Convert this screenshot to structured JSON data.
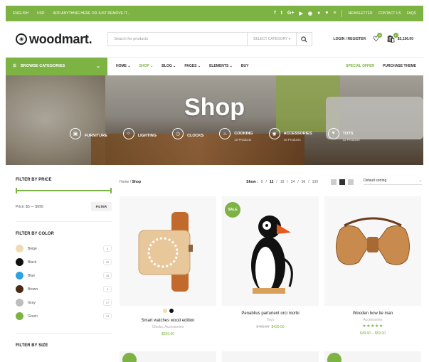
{
  "topbar": {
    "language": "ENGLISH",
    "currency": "USD",
    "promo": "ADD ANYTHING HERE OR JUST REMOVE IT...",
    "social": [
      "f",
      "t",
      "G+",
      "▶",
      "◉",
      "●",
      "♥",
      "≡"
    ],
    "newsletter": "NEWSLETTER",
    "contact": "CONTACT US",
    "faqs": "FAQS"
  },
  "header": {
    "logo": "woodmart.",
    "search_placeholder": "Search for products",
    "category": "SELECT CATEGORY",
    "login": "LOGIN / REGISTER",
    "wishlist_count": "0",
    "cart_count": "2",
    "cart_total": "$3,156.00"
  },
  "nav": {
    "browse": "BROWSE CATEGORIES",
    "items": [
      "HOME",
      "SHOP",
      "BLOG",
      "PAGES",
      "ELEMENTS",
      "BUY"
    ],
    "special_offer": "SPECIAL OFFER",
    "purchase": "PURCHASE THEME"
  },
  "hero": {
    "title": "Shop",
    "categories": [
      {
        "name": "FURNITURE",
        "count": "",
        "icon": "chair-icon"
      },
      {
        "name": "LIGHTING",
        "count": "",
        "icon": "lamp-icon"
      },
      {
        "name": "CLOCKS",
        "count": "",
        "icon": "clock-icon"
      },
      {
        "name": "COOKING",
        "count": "10 Products",
        "icon": "pot-icon"
      },
      {
        "name": "ACCESSORIES",
        "count": "16 Products",
        "icon": "bag-icon"
      },
      {
        "name": "TOYS",
        "count": "12 Products",
        "icon": "toy-icon"
      }
    ]
  },
  "sidebar": {
    "price_title": "FILTER BY PRICE",
    "price_range": "Price: $5 — $999",
    "filter_btn": "FILTER",
    "color_title": "FILTER BY COLOR",
    "colors": [
      {
        "name": "Beige",
        "count": "4",
        "hex": "#f0dcb4"
      },
      {
        "name": "Black",
        "count": "20",
        "hex": "#111111"
      },
      {
        "name": "Blue",
        "count": "18",
        "hex": "#2aa3e0"
      },
      {
        "name": "Brown",
        "count": "9",
        "hex": "#4a2a14"
      },
      {
        "name": "Gray",
        "count": "17",
        "hex": "#bdbdbd"
      },
      {
        "name": "Green",
        "count": "13",
        "hex": "#7cb342"
      }
    ],
    "size_title": "FILTER BY SIZE"
  },
  "toolbar": {
    "crumb_home": "Home",
    "crumb_sep": " / ",
    "crumb_current": "Shop",
    "show_label": "Show :",
    "show_options": [
      "9",
      "12",
      "18",
      "24",
      "36"
    ],
    "show_extra": "100",
    "show_current": "12",
    "sort": "Default sorting"
  },
  "products": [
    {
      "name": "Smart watches wood edition",
      "category": "Clocks, Accessories",
      "old_price": "",
      "price": "$599.00",
      "sale": "",
      "stars": ""
    },
    {
      "name": "Penablius parturient orci morbi",
      "category": "Toys",
      "old_price": "$499.00",
      "price": "$439.00",
      "sale": "SALE",
      "stars": ""
    },
    {
      "name": "Wooden bow tie man",
      "category": "Accessories",
      "old_price": "",
      "price": "$49.00 – $59.00",
      "sale": "",
      "stars": "★★★★★"
    }
  ],
  "colors": {
    "accent": "#7cb342"
  }
}
